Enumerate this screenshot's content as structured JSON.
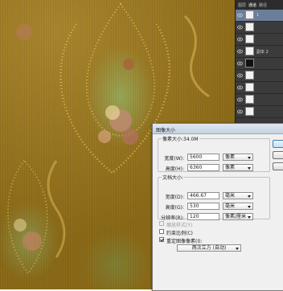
{
  "layers_panel": {
    "tabs": [
      "图层",
      "通道",
      "路径"
    ],
    "active_tab": 1,
    "items": [
      {
        "label": "1",
        "thumb": "white"
      },
      {
        "label": "",
        "thumb": "white"
      },
      {
        "label": "",
        "thumb": "white"
      },
      {
        "label": "副本 2",
        "thumb": "white"
      },
      {
        "label": "",
        "thumb": "dark"
      },
      {
        "label": "",
        "thumb": "white"
      },
      {
        "label": "",
        "thumb": "white"
      },
      {
        "label": "",
        "thumb": "white"
      },
      {
        "label": "",
        "thumb": "white"
      }
    ]
  },
  "dialog": {
    "title": "图像大小",
    "pixel_dimensions": {
      "legend": "像素大小:34.0M",
      "width_label": "宽度(W):",
      "width_value": "5600",
      "width_unit": "像素",
      "height_label": "高度(H):",
      "height_value": "6360",
      "height_unit": "像素"
    },
    "document_size": {
      "legend": "文档大小:",
      "width_label": "宽度(D):",
      "width_value": "466.67",
      "width_unit": "毫米",
      "height_label": "高度(G):",
      "height_value": "530",
      "height_unit": "毫米",
      "resolution_label": "分辨率(R):",
      "resolution_value": "120",
      "resolution_unit": "像素/厘米"
    },
    "checkboxes": {
      "scale_styles": {
        "label": "缩放样式(Y)",
        "checked": false,
        "disabled": true
      },
      "constrain": {
        "label": "约束比例(C)",
        "checked": false,
        "disabled": false
      },
      "resample": {
        "label": "重定图像像素(I):",
        "checked": true,
        "disabled": false
      }
    },
    "resample_method": "两次立方 (自动)"
  },
  "colors": {
    "panel_bg": "#3b3b3b",
    "selected_layer": "#6a7e9a",
    "dialog_bg": "#f0f0f0"
  }
}
